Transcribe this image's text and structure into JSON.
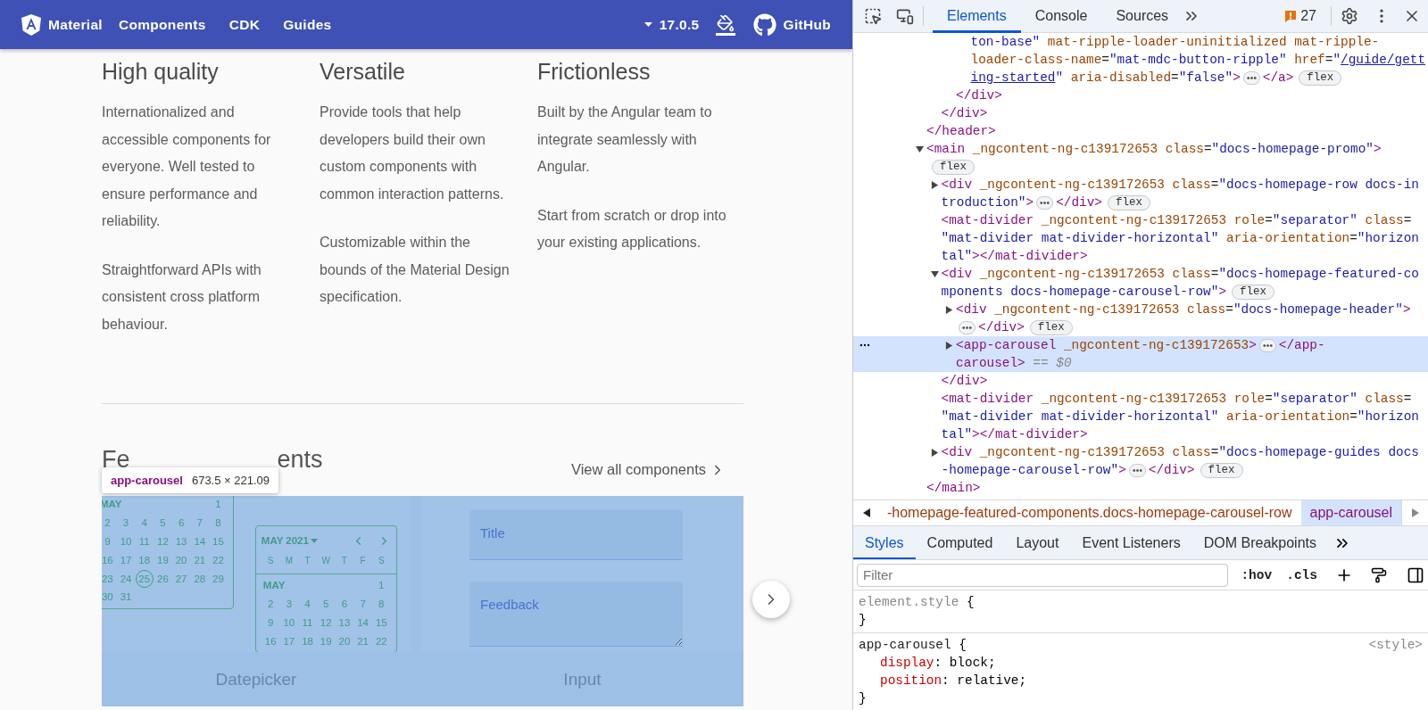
{
  "site": {
    "title": "Material",
    "nav": [
      "Components",
      "CDK",
      "Guides"
    ],
    "version": "17.0.5",
    "github": "GitHub"
  },
  "features": [
    {
      "title": "High quality",
      "paragraphs": [
        "Internationalized and accessible components for everyone. Well tested to ensure performance and reliability.",
        "Straightforward APIs with consistent cross platform behaviour."
      ]
    },
    {
      "title": "Versatile",
      "paragraphs": [
        "Provide tools that help developers build their own custom components with common interaction patterns.",
        "Customizable within the bounds of the Material Design specification."
      ]
    },
    {
      "title": "Frictionless",
      "paragraphs": [
        "Built by the Angular team to integrate seamlessly with Angular.",
        "Start from scratch or drop into your existing applications."
      ]
    }
  ],
  "featured": {
    "title_parts": [
      "Fe",
      "ents"
    ],
    "view_all": "View all components",
    "items": [
      {
        "kind": "datepicker",
        "label": "Datepicker",
        "calendars": [
          {
            "month": "MAY",
            "weeks": [
              [
                {
                  "d": "1",
                  "selected": false
                }
              ],
              [
                {
                  "d": "2",
                  "selected": false
                },
                {
                  "d": "3",
                  "selected": false
                },
                {
                  "d": "4",
                  "selected": false
                },
                {
                  "d": "5",
                  "selected": false
                },
                {
                  "d": "6",
                  "selected": false
                },
                {
                  "d": "7",
                  "selected": false
                },
                {
                  "d": "8",
                  "selected": false
                }
              ],
              [
                {
                  "d": "9",
                  "selected": false
                },
                {
                  "d": "10",
                  "selected": false
                },
                {
                  "d": "11",
                  "selected": false
                },
                {
                  "d": "12",
                  "selected": false
                },
                {
                  "d": "13",
                  "selected": false
                },
                {
                  "d": "14",
                  "selected": false
                },
                {
                  "d": "15",
                  "selected": false
                }
              ],
              [
                {
                  "d": "16",
                  "selected": false
                },
                {
                  "d": "17",
                  "selected": false
                },
                {
                  "d": "18",
                  "selected": false
                },
                {
                  "d": "19",
                  "selected": false
                },
                {
                  "d": "20",
                  "selected": false
                },
                {
                  "d": "21",
                  "selected": false
                },
                {
                  "d": "22",
                  "selected": false
                }
              ],
              [
                {
                  "d": "23",
                  "selected": false
                },
                {
                  "d": "24",
                  "selected": false
                },
                {
                  "d": "25",
                  "selected": true
                },
                {
                  "d": "26",
                  "selected": false
                },
                {
                  "d": "27",
                  "selected": false
                },
                {
                  "d": "28",
                  "selected": false
                },
                {
                  "d": "29",
                  "selected": false
                }
              ],
              [
                {
                  "d": "30",
                  "selected": false
                },
                {
                  "d": "31",
                  "selected": false
                }
              ]
            ]
          },
          {
            "period": "MAY 2021",
            "weekdays": [
              "S",
              "M",
              "T",
              "W",
              "T",
              "F",
              "S"
            ],
            "month": "MAY",
            "weeks": [
              [
                {
                  "d": "1",
                  "selected": false
                }
              ],
              [
                {
                  "d": "2",
                  "selected": false
                },
                {
                  "d": "3",
                  "selected": false
                },
                {
                  "d": "4",
                  "selected": false
                },
                {
                  "d": "5",
                  "selected": false
                },
                {
                  "d": "6",
                  "selected": false
                },
                {
                  "d": "7",
                  "selected": false
                },
                {
                  "d": "8",
                  "selected": false
                }
              ],
              [
                {
                  "d": "9",
                  "selected": false
                },
                {
                  "d": "10",
                  "selected": false
                },
                {
                  "d": "11",
                  "selected": false
                },
                {
                  "d": "12",
                  "selected": false
                },
                {
                  "d": "13",
                  "selected": false
                },
                {
                  "d": "14",
                  "selected": false
                },
                {
                  "d": "15",
                  "selected": false
                }
              ],
              [
                {
                  "d": "16",
                  "selected": false
                },
                {
                  "d": "17",
                  "selected": false
                },
                {
                  "d": "18",
                  "selected": false
                },
                {
                  "d": "19",
                  "selected": false
                },
                {
                  "d": "20",
                  "selected": false
                },
                {
                  "d": "21",
                  "selected": false
                },
                {
                  "d": "22",
                  "selected": false
                }
              ]
            ]
          }
        ]
      },
      {
        "kind": "input",
        "label": "Input",
        "fields": [
          {
            "placeholder": "Title",
            "multiline": false
          },
          {
            "placeholder": "Feedback",
            "multiline": true
          }
        ]
      }
    ]
  },
  "inspect_tooltip": {
    "tag": "app-carousel",
    "size": "673.5 × 221.09"
  },
  "devtools": {
    "tabs": [
      {
        "label": "Elements",
        "selected": true
      },
      {
        "label": "Console",
        "selected": false
      },
      {
        "label": "Sources",
        "selected": false
      }
    ],
    "issues": "27",
    "tree": [
      {
        "children": [
          {
            "children": [
              {
                "children": [
                  {
                    "selected": false,
                    "lines": [
                      [
                        {
                          "kind": "value",
                          "text": "ton-base\""
                        },
                        {
                          "kind": "attr",
                          "text": " mat-ripple-loader-uninitialized mat-ripple-"
                        }
                      ],
                      [
                        {
                          "kind": "attr",
                          "text": "loader-class-name"
                        },
                        {
                          "kind": "eq",
                          "text": "="
                        },
                        {
                          "kind": "value",
                          "text": "\"mat-mdc-button-ripple\""
                        },
                        {
                          "kind": "attr",
                          "text": " href"
                        },
                        {
                          "kind": "eq",
                          "text": "="
                        },
                        {
                          "kind": "value",
                          "text": "\""
                        },
                        {
                          "kind": "link",
                          "text": "/guide/gett"
                        }
                      ],
                      [
                        {
                          "kind": "link",
                          "text": "ing-started"
                        },
                        {
                          "kind": "value",
                          "text": "\""
                        },
                        {
                          "kind": "attr",
                          "text": " aria-disabled"
                        },
                        {
                          "kind": "eq",
                          "text": "="
                        },
                        {
                          "kind": "value",
                          "text": "\"false\""
                        },
                        {
                          "kind": "tag",
                          "text": ">"
                        },
                        {
                          "kind": "collapsed"
                        },
                        {
                          "kind": "tag",
                          "text": "</a>"
                        },
                        {
                          "kind": "badge",
                          "text": "flex"
                        }
                      ]
                    ]
                  }
                ],
                "close": [
                  {
                    "kind": "tag",
                    "text": "</div>"
                  }
                ]
              }
            ],
            "close": [
              {
                "kind": "tag",
                "text": "</div>"
              }
            ]
          }
        ],
        "close": [
          {
            "kind": "tag",
            "text": "</header>"
          }
        ]
      },
      {
        "selected": false,
        "expanded": true,
        "lines": [
          [
            {
              "kind": "tag",
              "text": "<main"
            },
            {
              "kind": "attr",
              "text": " _ngcontent-ng-c139172653 class"
            },
            {
              "kind": "eq",
              "text": "="
            },
            {
              "kind": "value",
              "text": "\"docs-homepage-promo\""
            },
            {
              "kind": "tag",
              "text": ">"
            }
          ],
          [
            {
              "kind": "badge",
              "text": "flex"
            }
          ]
        ],
        "children": [
          {
            "selected": false,
            "expanded": false,
            "lines": [
              [
                {
                  "kind": "tag",
                  "text": "<div"
                },
                {
                  "kind": "attr",
                  "text": " _ngcontent-ng-c139172653 class"
                },
                {
                  "kind": "eq",
                  "text": "="
                },
                {
                  "kind": "value",
                  "text": "\"docs-homepage-row docs-in"
                }
              ],
              [
                {
                  "kind": "value",
                  "text": "troduction\""
                },
                {
                  "kind": "tag",
                  "text": ">"
                },
                {
                  "kind": "collapsed"
                },
                {
                  "kind": "tag",
                  "text": "</div>"
                },
                {
                  "kind": "badge",
                  "text": "flex"
                }
              ]
            ]
          },
          {
            "selected": false,
            "lines": [
              [
                {
                  "kind": "tag",
                  "text": "<mat-divider"
                },
                {
                  "kind": "attr",
                  "text": " _ngcontent-ng-c139172653 role"
                },
                {
                  "kind": "eq",
                  "text": "="
                },
                {
                  "kind": "value",
                  "text": "\"separator\""
                },
                {
                  "kind": "attr",
                  "text": " class"
                },
                {
                  "kind": "eq",
                  "text": "="
                }
              ],
              [
                {
                  "kind": "value",
                  "text": "\"mat-divider mat-divider-horizontal\""
                },
                {
                  "kind": "attr",
                  "text": " aria-orientation"
                },
                {
                  "kind": "eq",
                  "text": "="
                },
                {
                  "kind": "value",
                  "text": "\"horizon"
                }
              ],
              [
                {
                  "kind": "value",
                  "text": "tal\""
                },
                {
                  "kind": "tag",
                  "text": "></mat-divider>"
                }
              ]
            ]
          },
          {
            "selected": false,
            "expanded": true,
            "lines": [
              [
                {
                  "kind": "tag",
                  "text": "<div"
                },
                {
                  "kind": "attr",
                  "text": " _ngcontent-ng-c139172653 class"
                },
                {
                  "kind": "eq",
                  "text": "="
                },
                {
                  "kind": "value",
                  "text": "\"docs-homepage-featured-co"
                }
              ],
              [
                {
                  "kind": "value",
                  "text": "mponents docs-homepage-carousel-row\""
                },
                {
                  "kind": "tag",
                  "text": ">"
                },
                {
                  "kind": "badge",
                  "text": "flex"
                }
              ]
            ],
            "children": [
              {
                "selected": false,
                "expanded": false,
                "lines": [
                  [
                    {
                      "kind": "tag",
                      "text": "<div"
                    },
                    {
                      "kind": "attr",
                      "text": " _ngcontent-ng-c139172653 class"
                    },
                    {
                      "kind": "eq",
                      "text": "="
                    },
                    {
                      "kind": "value",
                      "text": "\"docs-homepage-header\""
                    },
                    {
                      "kind": "tag",
                      "text": ">"
                    }
                  ],
                  [
                    {
                      "kind": "collapsed"
                    },
                    {
                      "kind": "tag",
                      "text": "</div>"
                    },
                    {
                      "kind": "badge",
                      "text": "flex"
                    }
                  ]
                ]
              },
              {
                "selected": true,
                "expanded": false,
                "lines": [
                  [
                    {
                      "kind": "tag",
                      "text": "<app-carousel"
                    },
                    {
                      "kind": "attr",
                      "text": " _ngcontent-ng-c139172653"
                    },
                    {
                      "kind": "tag",
                      "text": ">"
                    },
                    {
                      "kind": "collapsed"
                    },
                    {
                      "kind": "tag",
                      "text": "</app-"
                    }
                  ],
                  [
                    {
                      "kind": "tag",
                      "text": "carousel>"
                    },
                    {
                      "kind": "note",
                      "text": " == "
                    },
                    {
                      "kind": "var",
                      "text": "$0"
                    }
                  ]
                ]
              }
            ],
            "close": [
              {
                "kind": "tag",
                "text": "</div>"
              }
            ]
          },
          {
            "selected": false,
            "lines": [
              [
                {
                  "kind": "tag",
                  "text": "<mat-divider"
                },
                {
                  "kind": "attr",
                  "text": " _ngcontent-ng-c139172653 role"
                },
                {
                  "kind": "eq",
                  "text": "="
                },
                {
                  "kind": "value",
                  "text": "\"separator\""
                },
                {
                  "kind": "attr",
                  "text": " class"
                },
                {
                  "kind": "eq",
                  "text": "="
                }
              ],
              [
                {
                  "kind": "value",
                  "text": "\"mat-divider mat-divider-horizontal\""
                },
                {
                  "kind": "attr",
                  "text": " aria-orientation"
                },
                {
                  "kind": "eq",
                  "text": "="
                },
                {
                  "kind": "value",
                  "text": "\"horizon"
                }
              ],
              [
                {
                  "kind": "value",
                  "text": "tal\""
                },
                {
                  "kind": "tag",
                  "text": "></mat-divider>"
                }
              ]
            ]
          },
          {
            "selected": false,
            "expanded": false,
            "lines": [
              [
                {
                  "kind": "tag",
                  "text": "<div"
                },
                {
                  "kind": "attr",
                  "text": " _ngcontent-ng-c139172653 class"
                },
                {
                  "kind": "eq",
                  "text": "="
                },
                {
                  "kind": "value",
                  "text": "\"docs-homepage-guides docs"
                }
              ],
              [
                {
                  "kind": "value",
                  "text": "-homepage-carousel-row\""
                },
                {
                  "kind": "tag",
                  "text": ">"
                },
                {
                  "kind": "collapsed"
                },
                {
                  "kind": "tag",
                  "text": "</div>"
                },
                {
                  "kind": "badge",
                  "text": "flex"
                }
              ]
            ]
          }
        ],
        "close": [
          {
            "kind": "tag",
            "text": "</main>"
          }
        ]
      }
    ],
    "breadcrumbs": [
      {
        "label": "-homepage-featured-components.docs-homepage-carousel-row",
        "selected": false
      },
      {
        "label": "app-carousel",
        "selected": true
      }
    ],
    "panel_tabs": [
      {
        "label": "Styles",
        "selected": true
      },
      {
        "label": "Computed",
        "selected": false
      },
      {
        "label": "Layout",
        "selected": false
      },
      {
        "label": "Event Listeners",
        "selected": false
      },
      {
        "label": "DOM Breakpoints",
        "selected": false
      }
    ],
    "filter": {
      "placeholder": "Filter"
    },
    "filter_buttons": [
      ":hov",
      ".cls"
    ],
    "rules": [
      {
        "kind": "inline",
        "selector": "element.style",
        "open": " {",
        "close": "}"
      },
      {
        "kind": "rule",
        "selector": "app-carousel",
        "open": " {",
        "close": "}",
        "source": "<style>",
        "declarations": [
          {
            "property": "display",
            "value": ": block;"
          },
          {
            "property": "position",
            "value": ": relative;"
          }
        ]
      }
    ]
  }
}
